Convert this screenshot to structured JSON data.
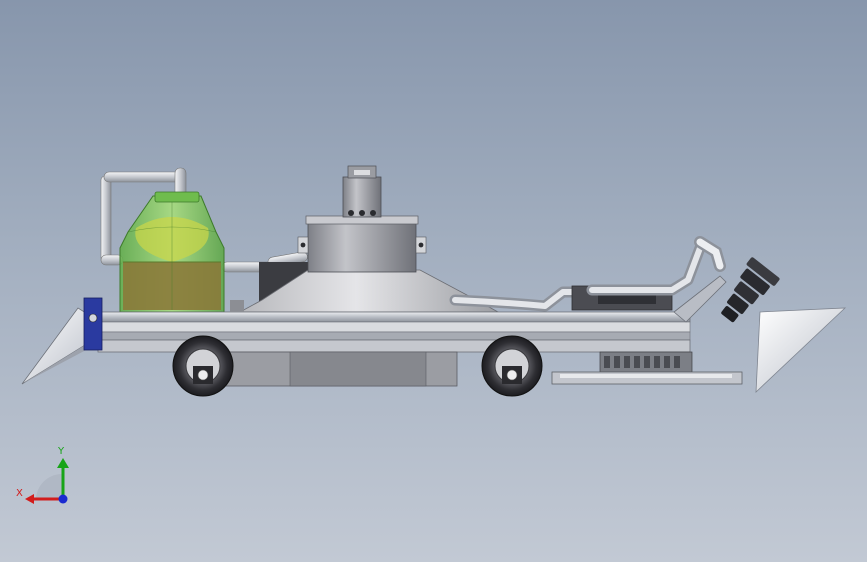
{
  "viewport": {
    "background_top": "#8796ac",
    "background_bottom": "#c2c9d4"
  },
  "model": {
    "parts": [
      "water-tank",
      "water-pipe",
      "main-chassis",
      "front-scraper",
      "rear-wheel",
      "front-wheel",
      "central-hopper",
      "fan-motor",
      "suction-duct",
      "suction-nozzle",
      "side-brush-plate"
    ],
    "colors": {
      "frame": "#c9ccd2",
      "tank_glass": "#79c45a",
      "tank_liquid": "#8a7a3a",
      "tire": "#3a3a3e",
      "nozzle": "#2a2a2e",
      "bracket": "#2a3aa0"
    }
  },
  "triad": {
    "x_label": "X",
    "y_label": "Y",
    "x_color": "#d21c1c",
    "y_color": "#18a418",
    "z_color": "#1a2ad0"
  }
}
